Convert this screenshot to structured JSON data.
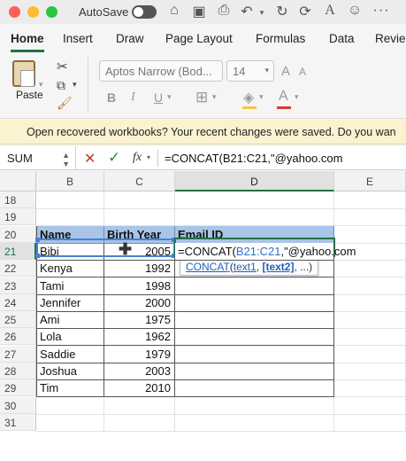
{
  "titlebar": {
    "autosave_label": "AutoSave",
    "icons": [
      "home-icon",
      "save-icon",
      "print-icon",
      "undo-icon",
      "redo-icon",
      "refresh-icon",
      "text-icon",
      "smiley-icon"
    ]
  },
  "tabs": [
    "Home",
    "Insert",
    "Draw",
    "Page Layout",
    "Formulas",
    "Data",
    "Revie"
  ],
  "ribbon": {
    "paste_label": "Paste",
    "font_name": "Aptos Narrow (Bod...",
    "font_size": "14",
    "bold": "B",
    "italic": "I",
    "underline": "U"
  },
  "message_bar": {
    "text": "Open recovered workbooks?  Your recent changes were saved. Do you wan"
  },
  "formula_bar": {
    "name_box": "SUM",
    "fx": "fx",
    "formula": "=CONCAT(B21:C21,\"@yahoo.com"
  },
  "columns": [
    "B",
    "C",
    "D",
    "E"
  ],
  "rows": [
    "18",
    "19",
    "20",
    "21",
    "22",
    "23",
    "24",
    "25",
    "26",
    "27",
    "28",
    "29",
    "30",
    "31"
  ],
  "table": {
    "headers": [
      "Name",
      "Birth Year",
      "Email ID"
    ],
    "data": [
      [
        "Bibi",
        "2005"
      ],
      [
        "Kenya",
        "1992"
      ],
      [
        "Tami",
        "1998"
      ],
      [
        "Jennifer",
        "2000"
      ],
      [
        "Ami",
        "1975"
      ],
      [
        "Lola",
        "1962"
      ],
      [
        "Saddie",
        "1979"
      ],
      [
        "Joshua",
        "2003"
      ],
      [
        "Tim",
        "2010"
      ]
    ],
    "editing_formula_prefix": "=CONCAT(",
    "editing_formula_ref": "B21:C21",
    "editing_formula_suffix": ",\"@yahoo.com"
  },
  "tooltip": {
    "fn": "CONCAT",
    "open": "(",
    "arg1": "text1",
    "sep": ", ",
    "arg2": "[text2]",
    "rest": ", ...)"
  },
  "colors": {
    "accent": "#217346",
    "header_fill": "#a8c4e6",
    "range_border": "#4a7fd6"
  }
}
